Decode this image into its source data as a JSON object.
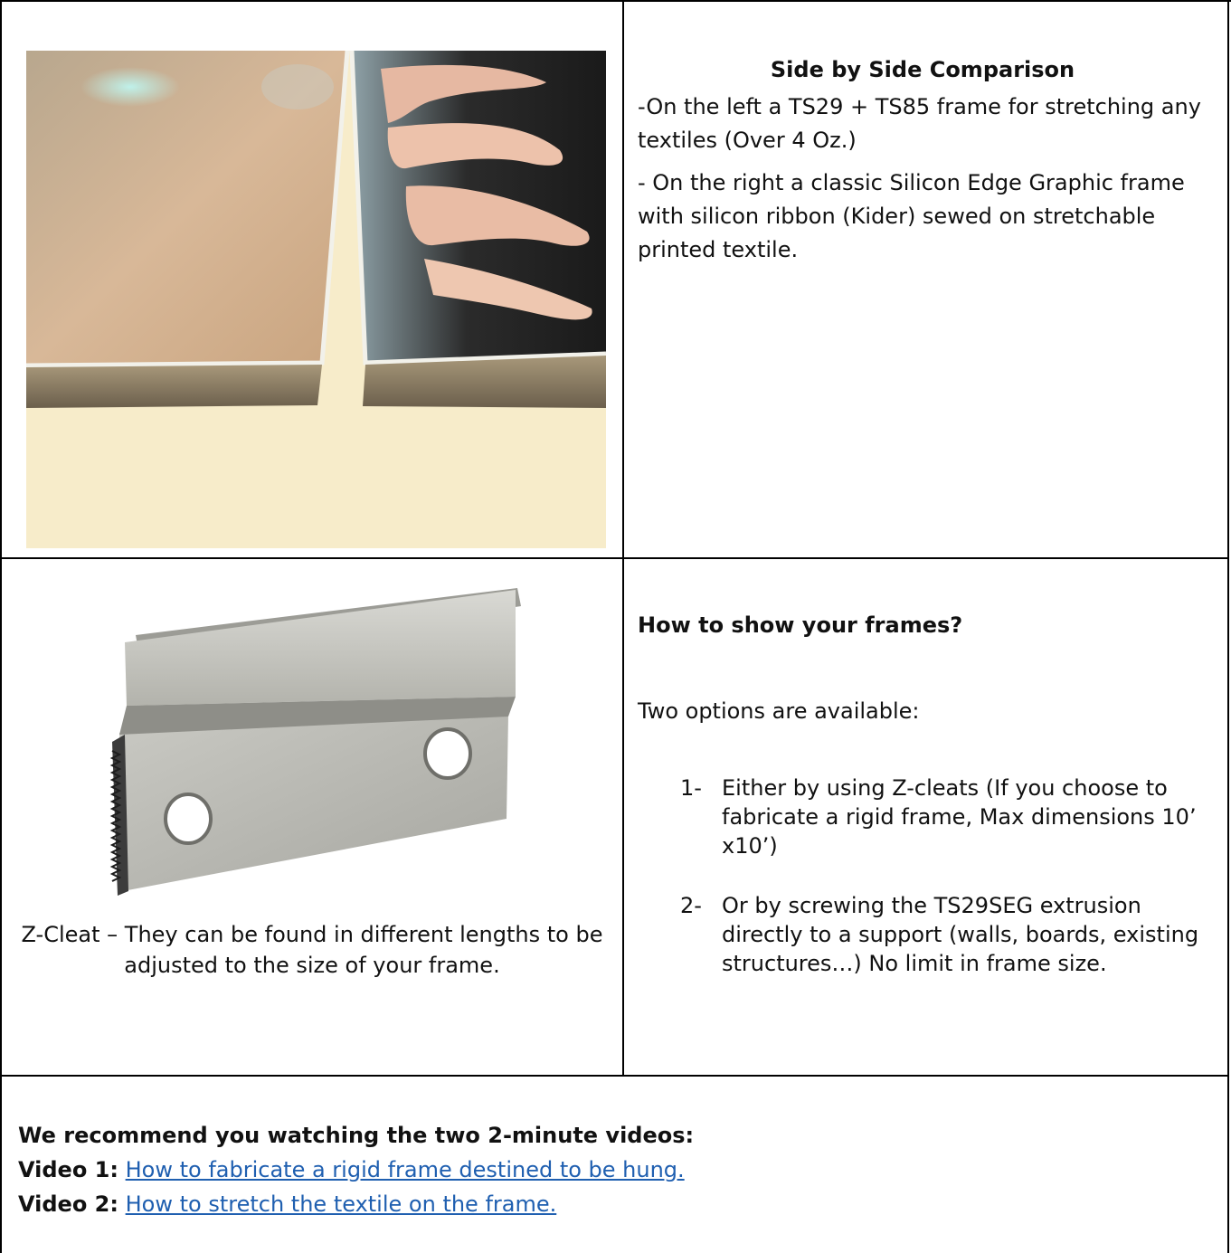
{
  "row1": {
    "heading": "Side by Side Comparison",
    "paragraph1": "-On the left a TS29 + TS85 frame for stretching any textiles (Over 4 Oz.)",
    "paragraph2": "- On the right a classic Silicon Edge Graphic frame with silicon ribbon (Kider) sewed on stretchable printed textile."
  },
  "row2": {
    "caption": "Z-Cleat – They can be found in different lengths to be adjusted to the size of your frame.",
    "heading": "How to show your frames?",
    "intro": "Two options are available:",
    "options": [
      {
        "num": "1-",
        "text": "Either by using Z-cleats (If you choose to fabricate a rigid frame, Max dimensions 10’ x10’)"
      },
      {
        "num": "2-",
        "text": "Or by screwing the TS29SEG extrusion directly to a support (walls, boards, existing structures…) No limit in frame size."
      }
    ]
  },
  "row3": {
    "recommend": "We recommend you watching the two 2-minute videos:",
    "videos": [
      {
        "label": "Video 1:",
        "link_text": "How to fabricate a rigid frame destined to be hung."
      },
      {
        "label": "Video 2:",
        "link_text": "How to stretch the textile on the frame."
      }
    ]
  },
  "colors": {
    "link": "#1f5fb0",
    "border": "#000000",
    "photo_bg": "#f7ecca"
  }
}
